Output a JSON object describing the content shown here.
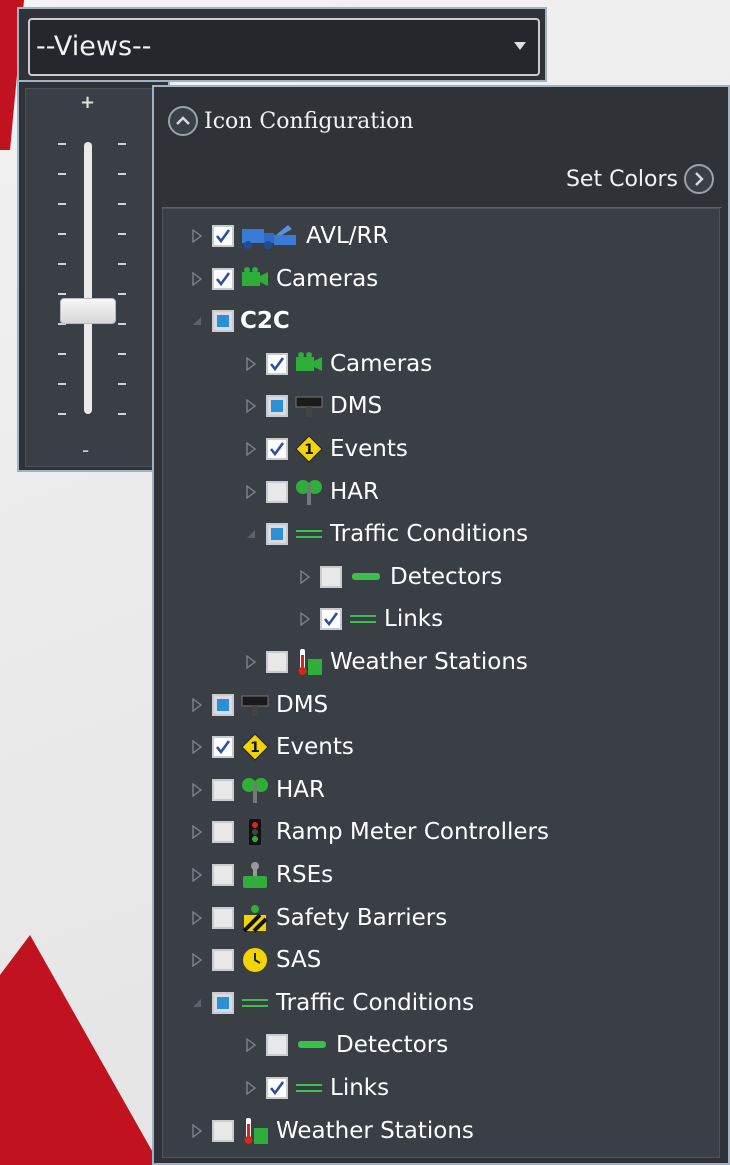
{
  "views": {
    "selected": "--Views--"
  },
  "zoom": {
    "plus": "+",
    "minus": "-",
    "level": 0.38
  },
  "config": {
    "title": "Icon Configuration",
    "set_colors": "Set Colors"
  },
  "tree": [
    {
      "label": "AVL/RR",
      "indent": 0,
      "expander": "collapsed",
      "check": "checked",
      "icon": "avl-truck-icon",
      "bold": false
    },
    {
      "label": "Cameras",
      "indent": 0,
      "expander": "collapsed",
      "check": "checked",
      "icon": "camera-icon",
      "bold": false
    },
    {
      "label": "C2C",
      "indent": 0,
      "expander": "expanded",
      "check": "partial",
      "icon": "",
      "bold": true
    },
    {
      "label": "Cameras",
      "indent": 1,
      "expander": "collapsed",
      "check": "checked",
      "icon": "camera-icon",
      "bold": false
    },
    {
      "label": "DMS",
      "indent": 1,
      "expander": "collapsed",
      "check": "partial",
      "icon": "dms-sign-icon",
      "bold": false
    },
    {
      "label": "Events",
      "indent": 1,
      "expander": "collapsed",
      "check": "checked",
      "icon": "event-warning-icon",
      "bold": false
    },
    {
      "label": "HAR",
      "indent": 1,
      "expander": "collapsed",
      "check": "unchecked",
      "icon": "har-radio-icon",
      "bold": false
    },
    {
      "label": "Traffic Conditions",
      "indent": 1,
      "expander": "expanded",
      "check": "partial",
      "icon": "traffic-line-icon",
      "bold": false
    },
    {
      "label": "Detectors",
      "indent": 2,
      "expander": "collapsed",
      "check": "unchecked",
      "icon": "detector-icon",
      "bold": false
    },
    {
      "label": "Links",
      "indent": 2,
      "expander": "collapsed",
      "check": "checked",
      "icon": "links-icon",
      "bold": false
    },
    {
      "label": "Weather Stations",
      "indent": 1,
      "expander": "collapsed",
      "check": "unchecked",
      "icon": "weather-station-icon",
      "bold": false
    },
    {
      "label": "DMS",
      "indent": 0,
      "expander": "collapsed",
      "check": "partial",
      "icon": "dms-sign-icon",
      "bold": false
    },
    {
      "label": "Events",
      "indent": 0,
      "expander": "collapsed",
      "check": "checked",
      "icon": "event-warning-icon",
      "bold": false
    },
    {
      "label": "HAR",
      "indent": 0,
      "expander": "collapsed",
      "check": "unchecked",
      "icon": "har-radio-icon",
      "bold": false
    },
    {
      "label": "Ramp Meter Controllers",
      "indent": 0,
      "expander": "collapsed",
      "check": "unchecked",
      "icon": "ramp-meter-icon",
      "bold": false
    },
    {
      "label": "RSEs",
      "indent": 0,
      "expander": "collapsed",
      "check": "unchecked",
      "icon": "rse-icon",
      "bold": false
    },
    {
      "label": "Safety Barriers",
      "indent": 0,
      "expander": "collapsed",
      "check": "unchecked",
      "icon": "safety-barrier-icon",
      "bold": false
    },
    {
      "label": "SAS",
      "indent": 0,
      "expander": "collapsed",
      "check": "unchecked",
      "icon": "sas-clock-icon",
      "bold": false
    },
    {
      "label": "Traffic Conditions",
      "indent": 0,
      "expander": "expanded",
      "check": "partial",
      "icon": "traffic-line-icon",
      "bold": false
    },
    {
      "label": "Detectors",
      "indent": 1,
      "expander": "collapsed",
      "check": "unchecked",
      "icon": "detector-icon",
      "bold": false
    },
    {
      "label": "Links",
      "indent": 1,
      "expander": "collapsed",
      "check": "checked",
      "icon": "links-icon",
      "bold": false
    },
    {
      "label": "Weather Stations",
      "indent": 0,
      "expander": "collapsed",
      "check": "unchecked",
      "icon": "weather-station-icon",
      "bold": false
    }
  ]
}
